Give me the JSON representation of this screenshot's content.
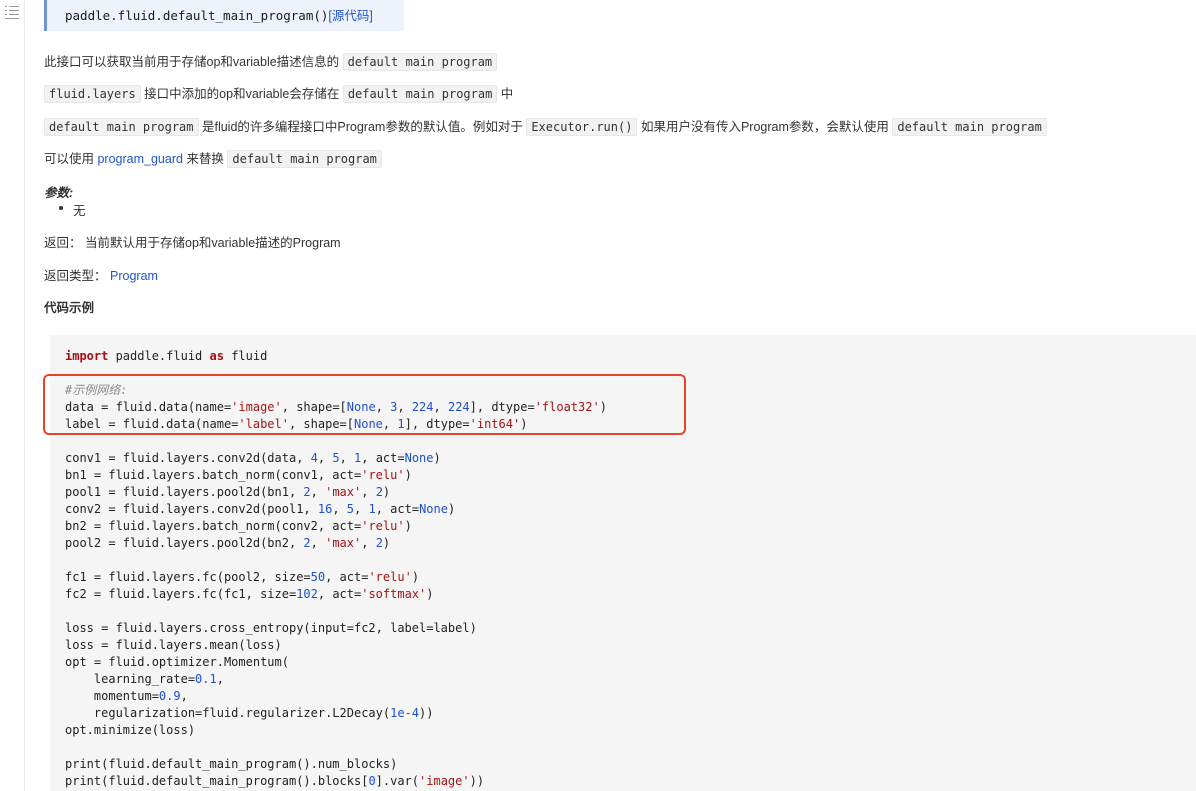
{
  "toc_icon": "menu-list-icon",
  "signature": {
    "code": "paddle.fluid.default_main_program()",
    "source_link": "[源代码]"
  },
  "paragraphs": {
    "p1": {
      "text": "此接口可以获取当前用于存储op和variable描述信息的 ",
      "code": "default main program"
    },
    "p2": {
      "code1": "fluid.layers",
      "text1": " 接口中添加的op和variable会存储在 ",
      "code2": "default main program",
      "text2": " 中"
    },
    "p3": {
      "code1": "default main program",
      "text1": " 是fluid的许多编程接口中Program参数的默认值。例如对于 ",
      "code2": "Executor.run()",
      "text2": " 如果用户没有传入Program参数，会默认使用 ",
      "code3": "default main program"
    },
    "p4": {
      "text1": "可以使用 ",
      "link": "program_guard",
      "text2": " 来替换 ",
      "code": "default main program"
    }
  },
  "params": {
    "heading": "参数:",
    "item": "无"
  },
  "returns": {
    "label": "返回：",
    "text": " 当前默认用于存储op和variable描述的Program"
  },
  "return_type": {
    "label": "返回类型：",
    "link": "Program"
  },
  "example_heading": "代码示例",
  "highlight_color": "#e2452a",
  "code_lines": [
    [
      [
        "import",
        "kw"
      ],
      [
        " paddle.fluid ",
        ""
      ],
      [
        "as",
        "kw"
      ],
      [
        " fluid",
        ""
      ]
    ],
    [],
    [
      [
        "#示例网络:",
        "cmt"
      ]
    ],
    [
      [
        "data = fluid.data(name=",
        ""
      ],
      [
        "'image'",
        "str"
      ],
      [
        ", shape=[",
        ""
      ],
      [
        "None",
        "none"
      ],
      [
        ", ",
        ""
      ],
      [
        "3",
        "num"
      ],
      [
        ", ",
        ""
      ],
      [
        "224",
        "num"
      ],
      [
        ", ",
        ""
      ],
      [
        "224",
        "num"
      ],
      [
        "], dtype=",
        ""
      ],
      [
        "'float32'",
        "str"
      ],
      [
        ")",
        ""
      ]
    ],
    [
      [
        "label = fluid.data(name=",
        ""
      ],
      [
        "'label'",
        "str"
      ],
      [
        ", shape=[",
        ""
      ],
      [
        "None",
        "none"
      ],
      [
        ", ",
        ""
      ],
      [
        "1",
        "num"
      ],
      [
        "], dtype=",
        ""
      ],
      [
        "'int64'",
        "str"
      ],
      [
        ")",
        ""
      ]
    ],
    [],
    [
      [
        "conv1 = fluid.layers.conv2d(data, ",
        ""
      ],
      [
        "4",
        "num"
      ],
      [
        ", ",
        ""
      ],
      [
        "5",
        "num"
      ],
      [
        ", ",
        ""
      ],
      [
        "1",
        "num"
      ],
      [
        ", act=",
        ""
      ],
      [
        "None",
        "none"
      ],
      [
        ")",
        ""
      ]
    ],
    [
      [
        "bn1 = fluid.layers.batch_norm(conv1, act=",
        ""
      ],
      [
        "'relu'",
        "str"
      ],
      [
        ")",
        ""
      ]
    ],
    [
      [
        "pool1 = fluid.layers.pool2d(bn1, ",
        ""
      ],
      [
        "2",
        "num"
      ],
      [
        ", ",
        ""
      ],
      [
        "'max'",
        "str"
      ],
      [
        ", ",
        ""
      ],
      [
        "2",
        "num"
      ],
      [
        ")",
        ""
      ]
    ],
    [
      [
        "conv2 = fluid.layers.conv2d(pool1, ",
        ""
      ],
      [
        "16",
        "num"
      ],
      [
        ", ",
        ""
      ],
      [
        "5",
        "num"
      ],
      [
        ", ",
        ""
      ],
      [
        "1",
        "num"
      ],
      [
        ", act=",
        ""
      ],
      [
        "None",
        "none"
      ],
      [
        ")",
        ""
      ]
    ],
    [
      [
        "bn2 = fluid.layers.batch_norm(conv2, act=",
        ""
      ],
      [
        "'relu'",
        "str"
      ],
      [
        ")",
        ""
      ]
    ],
    [
      [
        "pool2 = fluid.layers.pool2d(bn2, ",
        ""
      ],
      [
        "2",
        "num"
      ],
      [
        ", ",
        ""
      ],
      [
        "'max'",
        "str"
      ],
      [
        ", ",
        ""
      ],
      [
        "2",
        "num"
      ],
      [
        ")",
        ""
      ]
    ],
    [],
    [
      [
        "fc1 = fluid.layers.fc(pool2, size=",
        ""
      ],
      [
        "50",
        "num"
      ],
      [
        ", act=",
        ""
      ],
      [
        "'relu'",
        "str"
      ],
      [
        ")",
        ""
      ]
    ],
    [
      [
        "fc2 = fluid.layers.fc(fc1, size=",
        ""
      ],
      [
        "102",
        "num"
      ],
      [
        ", act=",
        ""
      ],
      [
        "'softmax'",
        "str"
      ],
      [
        ")",
        ""
      ]
    ],
    [],
    [
      [
        "loss = fluid.layers.cross_entropy(input=fc2, label=label)",
        ""
      ]
    ],
    [
      [
        "loss = fluid.layers.mean(loss)",
        ""
      ]
    ],
    [
      [
        "opt = fluid.optimizer.Momentum(",
        ""
      ]
    ],
    [
      [
        "    learning_rate=",
        ""
      ],
      [
        "0.1",
        "num"
      ],
      [
        ",",
        ""
      ]
    ],
    [
      [
        "    momentum=",
        ""
      ],
      [
        "0.9",
        "num"
      ],
      [
        ",",
        ""
      ]
    ],
    [
      [
        "    regularization=fluid.regularizer.L2Decay(",
        ""
      ],
      [
        "1e-4",
        "num"
      ],
      [
        "))",
        ""
      ]
    ],
    [
      [
        "opt.minimize(loss)",
        ""
      ]
    ],
    [],
    [
      [
        "print(fluid.default_main_program().num_blocks)",
        ""
      ]
    ],
    [
      [
        "print(fluid.default_main_program().blocks[",
        ""
      ],
      [
        "0",
        "num"
      ],
      [
        "].var(",
        ""
      ],
      [
        "'image'",
        "str"
      ],
      [
        "))",
        ""
      ]
    ]
  ]
}
